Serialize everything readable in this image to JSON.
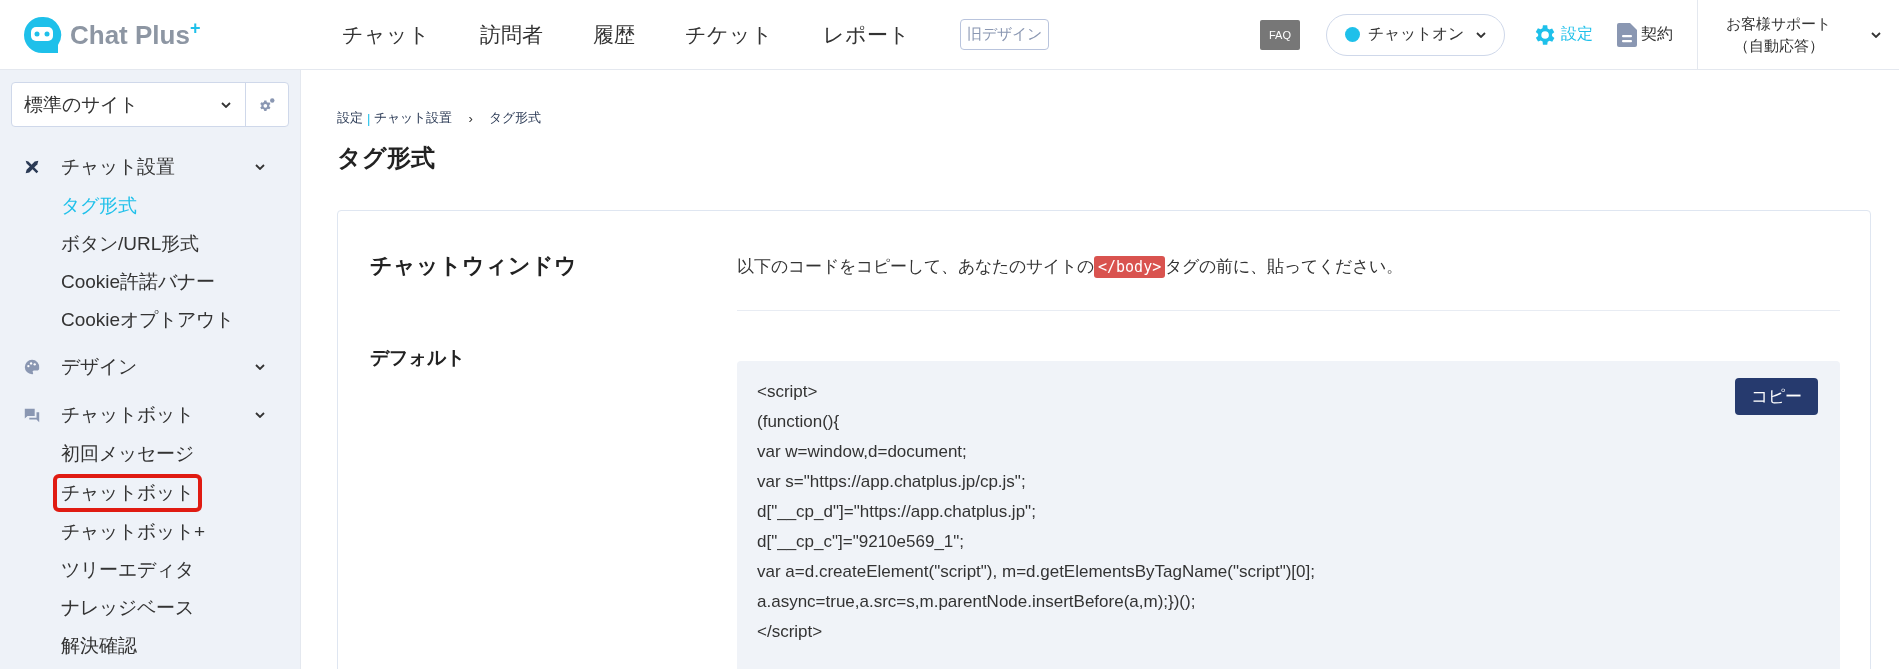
{
  "header": {
    "logo": {
      "text": "Chat Plus",
      "sup": "+"
    },
    "nav": [
      {
        "label": "チャット"
      },
      {
        "label": "訪問者"
      },
      {
        "label": "履歴"
      },
      {
        "label": "チケット"
      },
      {
        "label": "レポート"
      }
    ],
    "old_design_button": "旧デザイン",
    "faq_label": "FAQ",
    "status": {
      "label": "チャットオン",
      "color": "#1ec0ea"
    },
    "settings_link": "設定",
    "contract_link": "契約",
    "support": {
      "line1": "お客様サポート",
      "line2": "（自動応答）"
    }
  },
  "sidebar": {
    "site_select": "標準のサイト",
    "groups": [
      {
        "label": "チャット設置",
        "children": [
          {
            "label": "タグ形式",
            "selected": true,
            "highlighted": false
          },
          {
            "label": "ボタン/URL形式",
            "selected": false,
            "highlighted": false
          },
          {
            "label": "Cookie許諾バナー",
            "selected": false,
            "highlighted": false
          },
          {
            "label": "Cookieオプトアウト",
            "selected": false,
            "highlighted": false
          }
        ]
      },
      {
        "label": "デザイン"
      },
      {
        "label": "チャットボット",
        "children": [
          {
            "label": "初回メッセージ",
            "selected": false,
            "highlighted": false
          },
          {
            "label": "チャットボット",
            "selected": false,
            "highlighted": true
          },
          {
            "label": "チャットボット+",
            "selected": false,
            "highlighted": false
          },
          {
            "label": "ツリーエディタ",
            "selected": false,
            "highlighted": false
          },
          {
            "label": "ナレッジベース",
            "selected": false,
            "highlighted": false
          },
          {
            "label": "解決確認",
            "selected": false,
            "highlighted": false
          }
        ]
      }
    ]
  },
  "main": {
    "breadcrumb": [
      {
        "label": "設定",
        "separator": "|"
      },
      {
        "label": "チャット設置",
        "separator": "›"
      },
      {
        "label": "タグ形式"
      }
    ],
    "title": "タグ形式",
    "card": {
      "section_title": "チャットウィンドウ",
      "instruction": {
        "before": "以下のコードをコピーして、あなたのサイトの",
        "tag": "</body>",
        "after": "タグの前に、貼ってください。"
      },
      "subsection_title": "デフォルト",
      "code_lines": [
        "<script>",
        "(function(){",
        "var w=window,d=document;",
        "var s=\"https://app.chatplus.jp/cp.js\";",
        "d[\"__cp_d\"]=\"https://app.chatplus.jp\";",
        "d[\"__cp_c\"]=\"9210e569_1\";",
        "var a=d.createElement(\"script\"), m=d.getElementsByTagName(\"script\")[0];",
        "a.async=true,a.src=s,m.parentNode.insertBefore(a,m);})();",
        "</script>"
      ],
      "copy_button": "コピー"
    }
  }
}
